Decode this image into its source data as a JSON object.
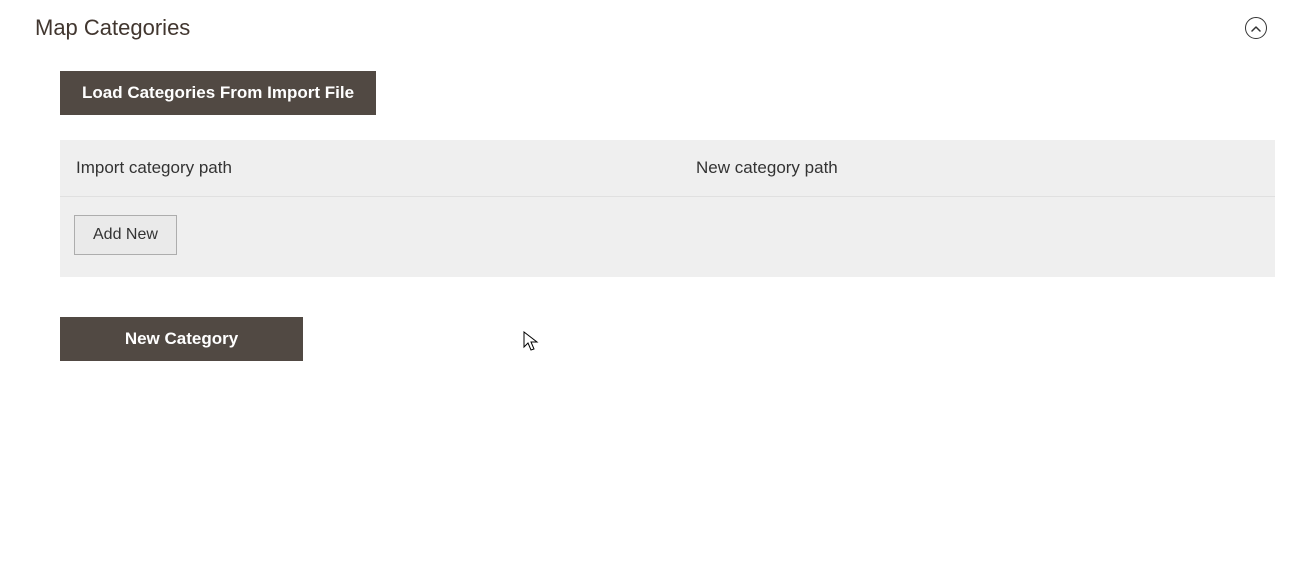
{
  "section": {
    "title": "Map Categories"
  },
  "buttons": {
    "load_categories": "Load Categories From Import File",
    "add_new": "Add New",
    "new_category": "New Category"
  },
  "table": {
    "headers": {
      "import_path": "Import category path",
      "new_path": "New category path"
    }
  }
}
